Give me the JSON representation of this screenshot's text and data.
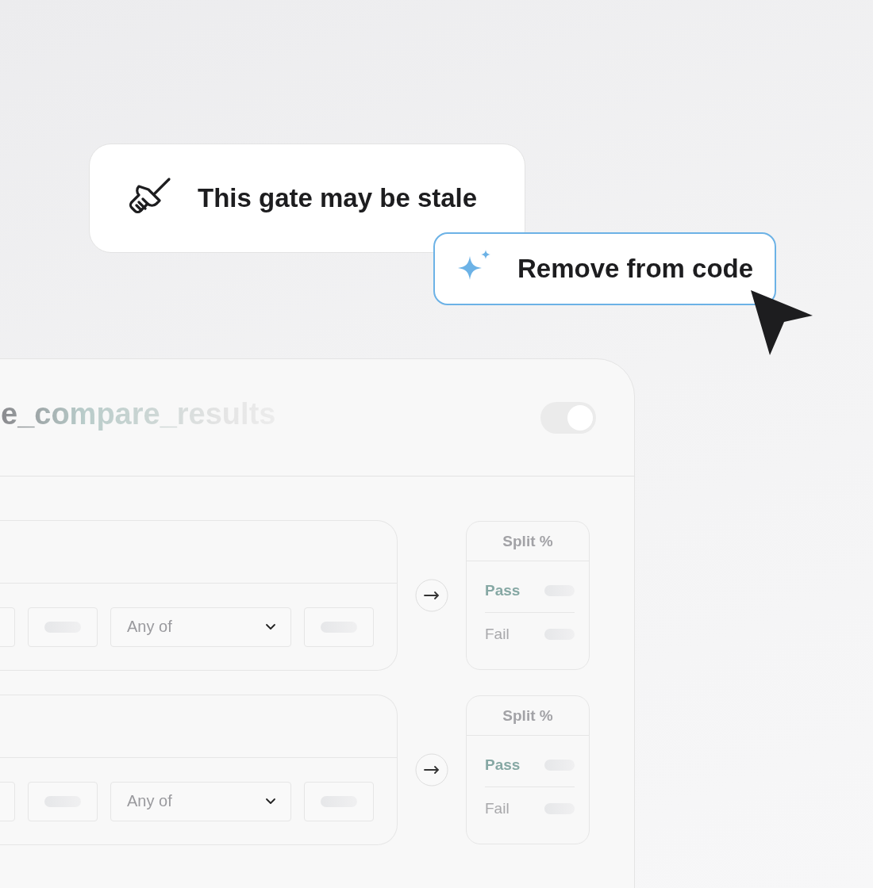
{
  "stale_notice": {
    "text": "This gate may be stale"
  },
  "action_button": {
    "label": "Remove from code"
  },
  "gate": {
    "name": "e_compare_results",
    "enabled": true
  },
  "rules": [
    {
      "operator": "Any of",
      "split": {
        "title": "Split %",
        "outcomes": [
          {
            "label": "Pass",
            "kind": "pass"
          },
          {
            "label": "Fail",
            "kind": "fail"
          }
        ]
      }
    },
    {
      "operator": "Any of",
      "split": {
        "title": "Split %",
        "outcomes": [
          {
            "label": "Pass",
            "kind": "pass"
          },
          {
            "label": "Fail",
            "kind": "fail"
          }
        ]
      }
    }
  ]
}
